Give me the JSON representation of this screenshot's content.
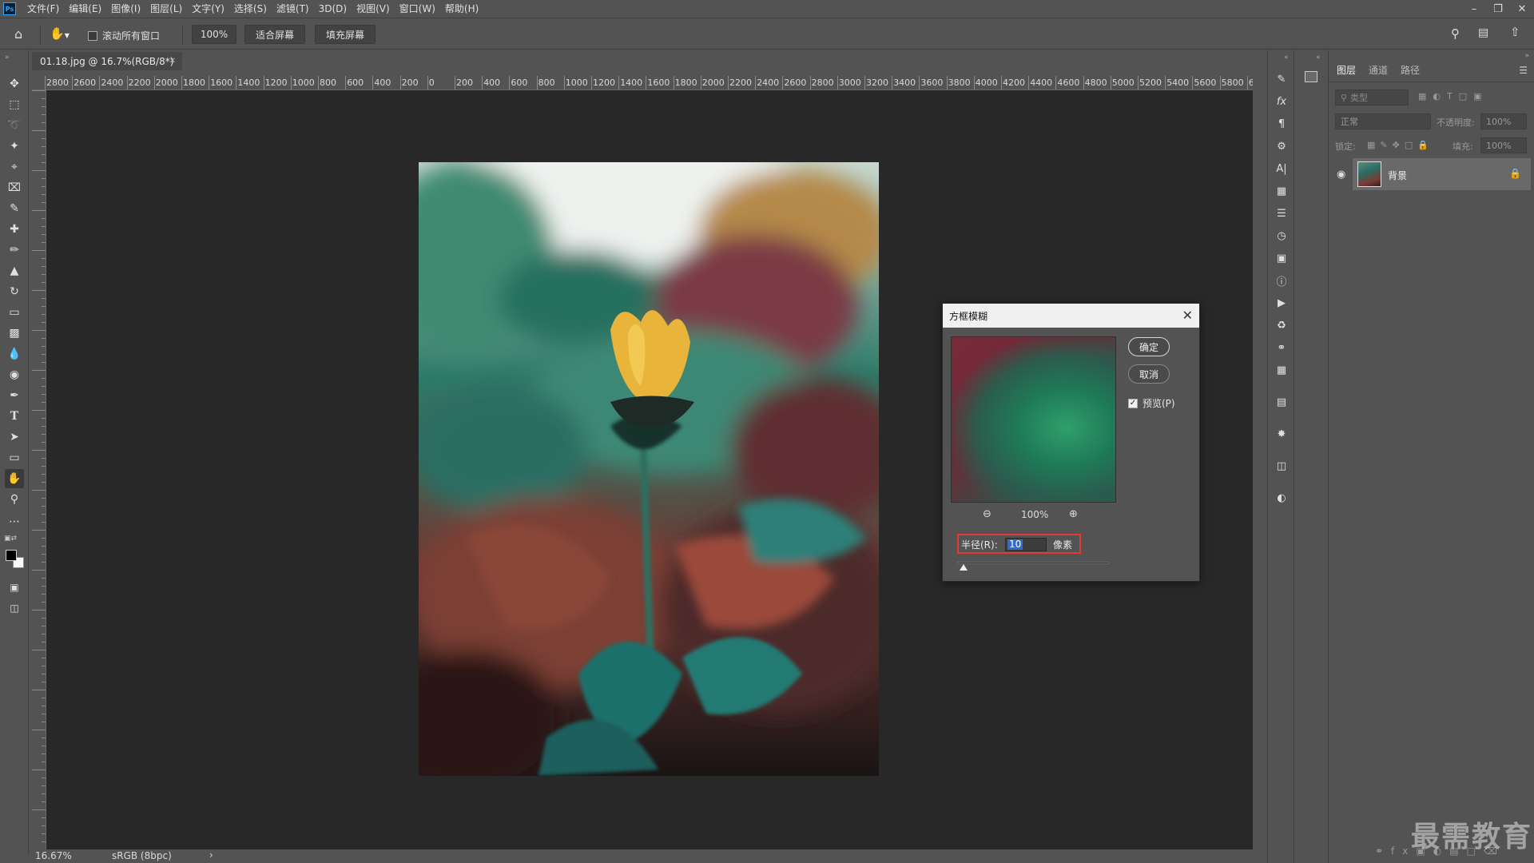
{
  "app": {
    "logo": "Ps",
    "menu": [
      "文件(F)",
      "编辑(E)",
      "图像(I)",
      "图层(L)",
      "文字(Y)",
      "选择(S)",
      "滤镜(T)",
      "3D(D)",
      "视图(V)",
      "窗口(W)",
      "帮助(H)"
    ]
  },
  "options_bar": {
    "scroll_all_label": "滚动所有窗口",
    "zoom_value": "100%",
    "fit_screen_label": "适合屏幕",
    "fill_screen_label": "填充屏幕"
  },
  "document": {
    "tab_title": "01.18.jpg @ 16.7%(RGB/8*)",
    "ruler_top": [
      "2800",
      "2600",
      "2400",
      "2200",
      "2000",
      "1800",
      "1600",
      "1400",
      "1200",
      "1000",
      "800",
      "600",
      "400",
      "200",
      "0",
      "200",
      "400",
      "600",
      "800",
      "1000",
      "1200",
      "1400",
      "1600",
      "1800",
      "2000",
      "2200",
      "2400",
      "2600",
      "2800",
      "3000",
      "3200",
      "3400",
      "3600",
      "3800",
      "4000",
      "4200",
      "4400",
      "4600",
      "4800",
      "5000",
      "5200",
      "5400",
      "5600",
      "5800",
      "6000",
      "6"
    ]
  },
  "status": {
    "zoom": "16.67%",
    "profile": "sRGB (8bpc)",
    "arrow": "›"
  },
  "layers_panel": {
    "tabs": [
      "图层",
      "通道",
      "路径"
    ],
    "filter_placeholder": "类型",
    "blend_mode": "正常",
    "opacity_label": "不透明度:",
    "opacity_value": "100%",
    "lock_label": "锁定:",
    "fill_label": "填充:",
    "fill_value": "100%",
    "layer_name": "背景"
  },
  "dialog": {
    "title": "方框模糊",
    "ok_label": "确定",
    "cancel_label": "取消",
    "preview_label": "预览(P)",
    "preview_checked": true,
    "zoom_value": "100%",
    "radius_label": "半径(R):",
    "radius_value": "10",
    "radius_unit": "像素"
  },
  "watermark": "最需教育"
}
